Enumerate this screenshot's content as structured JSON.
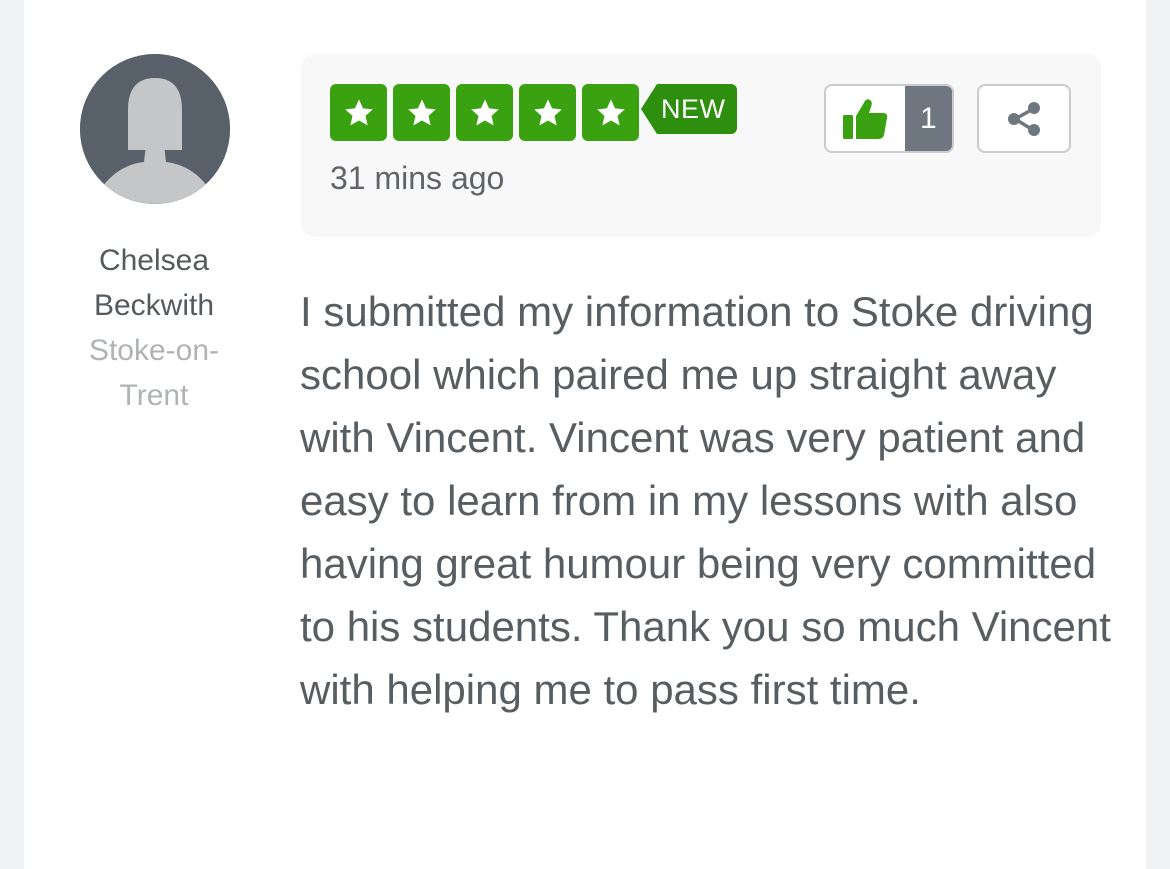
{
  "reviewer": {
    "name_line1": "Chelsea",
    "name_line2": "Beckwith",
    "location_line1": "Stoke-on-",
    "location_line2": "Trent"
  },
  "rating": {
    "stars": 5,
    "max": 5,
    "badge": "NEW",
    "star_color": "#3aa111"
  },
  "time_ago": "31 mins ago",
  "actions": {
    "like_icon": "thumbs-up-icon",
    "like_count": "1",
    "share_icon": "share-icon"
  },
  "review": {
    "text": "I submitted my information to Stoke driving school which paired me up straight away with Vincent. Vincent was very patient and easy to learn from in my lessons with also having great humour being very committed to his students. Thank you so much Vincent with helping me to pass first time."
  },
  "colors": {
    "accent_green": "#3aa111",
    "badge_green": "#2e8f0e",
    "count_bg": "#6e7780"
  }
}
